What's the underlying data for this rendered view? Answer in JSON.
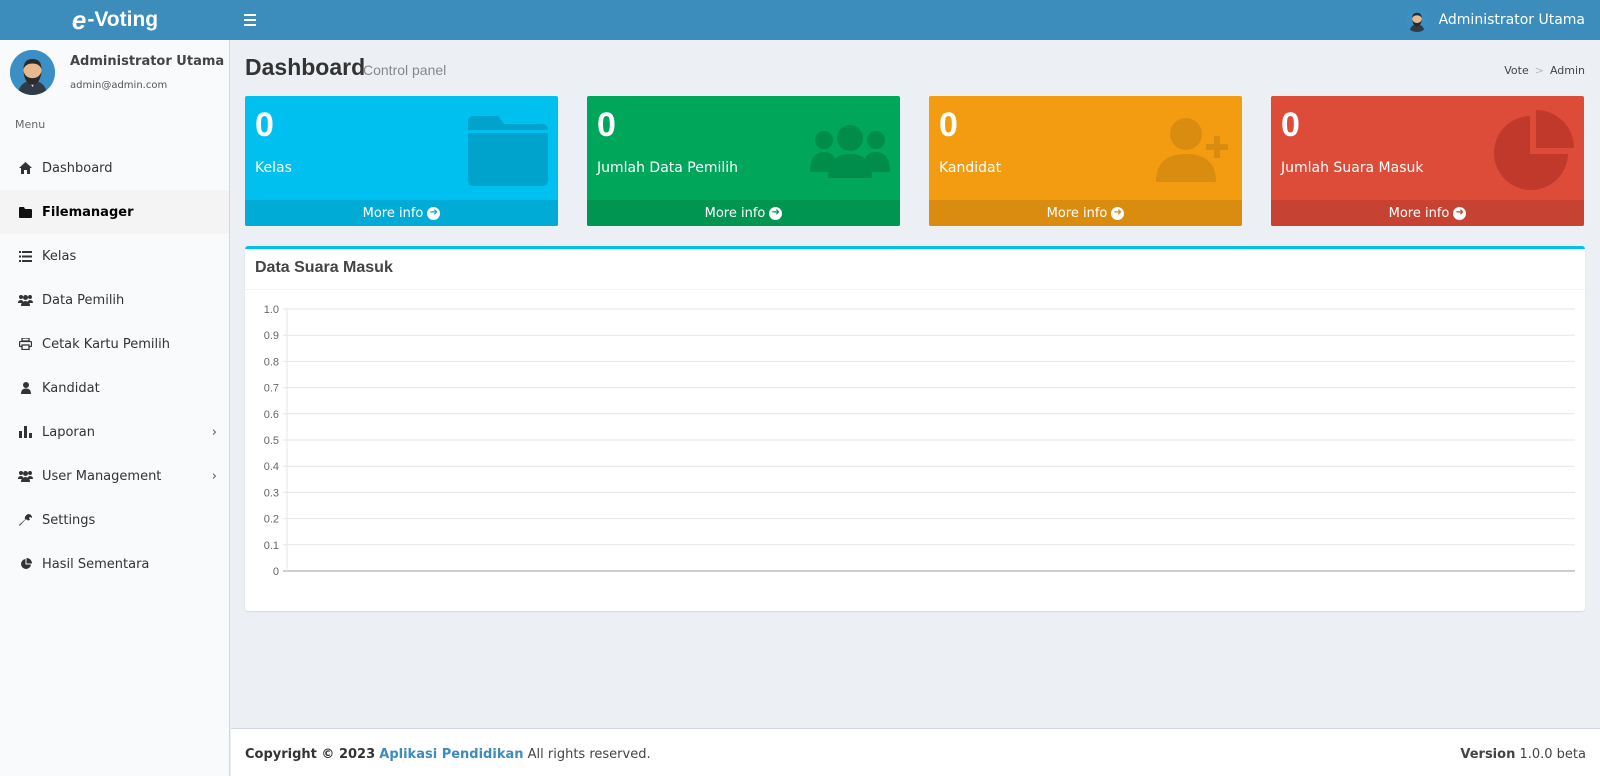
{
  "app": {
    "logo_mark": "e",
    "logo_text": "-Voting",
    "header_user_name": "Administrator Utama"
  },
  "sidebar": {
    "user_name": "Administrator Utama",
    "user_email": "admin@admin.com",
    "menu_header": "Menu",
    "items": [
      {
        "label": "Dashboard",
        "icon": "home-icon",
        "active": false,
        "has_submenu": false
      },
      {
        "label": "Filemanager",
        "icon": "folder-icon",
        "active": true,
        "has_submenu": false
      },
      {
        "label": "Kelas",
        "icon": "list-icon",
        "active": false,
        "has_submenu": false
      },
      {
        "label": "Data Pemilih",
        "icon": "users-icon",
        "active": false,
        "has_submenu": false
      },
      {
        "label": "Cetak Kartu Pemilih",
        "icon": "print-icon",
        "active": false,
        "has_submenu": false
      },
      {
        "label": "Kandidat",
        "icon": "user-icon",
        "active": false,
        "has_submenu": false
      },
      {
        "label": "Laporan",
        "icon": "bar-chart-icon",
        "active": false,
        "has_submenu": true
      },
      {
        "label": "User Management",
        "icon": "users-icon",
        "active": false,
        "has_submenu": true
      },
      {
        "label": "Settings",
        "icon": "wrench-icon",
        "active": false,
        "has_submenu": false
      },
      {
        "label": "Hasil Sementara",
        "icon": "pie-chart-icon",
        "active": false,
        "has_submenu": false
      }
    ]
  },
  "page": {
    "title": "Dashboard",
    "subtitle": "Control panel",
    "breadcrumb": [
      "Vote",
      "Admin"
    ]
  },
  "boxes": [
    {
      "value": "0",
      "label": "Kelas",
      "footer": "More info",
      "color": "#00c0ef",
      "footer_color": "#00acd6",
      "icon": "folder-icon"
    },
    {
      "value": "0",
      "label": "Jumlah Data Pemilih",
      "footer": "More info",
      "color": "#00a65a",
      "footer_color": "#009551",
      "icon": "users-icon"
    },
    {
      "value": "0",
      "label": "Kandidat",
      "footer": "More info",
      "color": "#f39c12",
      "footer_color": "#da8c10",
      "icon": "user-plus-icon"
    },
    {
      "value": "0",
      "label": "Jumlah Suara Masuk",
      "footer": "More info",
      "color": "#dd4b39",
      "footer_color": "#c64333",
      "icon": "pie-chart-icon"
    }
  ],
  "chart_box": {
    "title": "Data Suara Masuk"
  },
  "chart_data": {
    "type": "bar",
    "title": "",
    "xlabel": "",
    "ylabel": "",
    "categories": [],
    "values": [],
    "ylim": [
      0,
      1.0
    ],
    "yticks": [
      "1.0",
      "0.9",
      "0.8",
      "0.7",
      "0.6",
      "0.5",
      "0.4",
      "0.3",
      "0.2",
      "0.1",
      "0"
    ],
    "grid": true
  },
  "footer": {
    "copyright": "Copyright © 2023",
    "org": "Aplikasi Pendidikan",
    "rights": "All rights reserved.",
    "version_label": "Version",
    "version": "1.0.0 beta"
  }
}
